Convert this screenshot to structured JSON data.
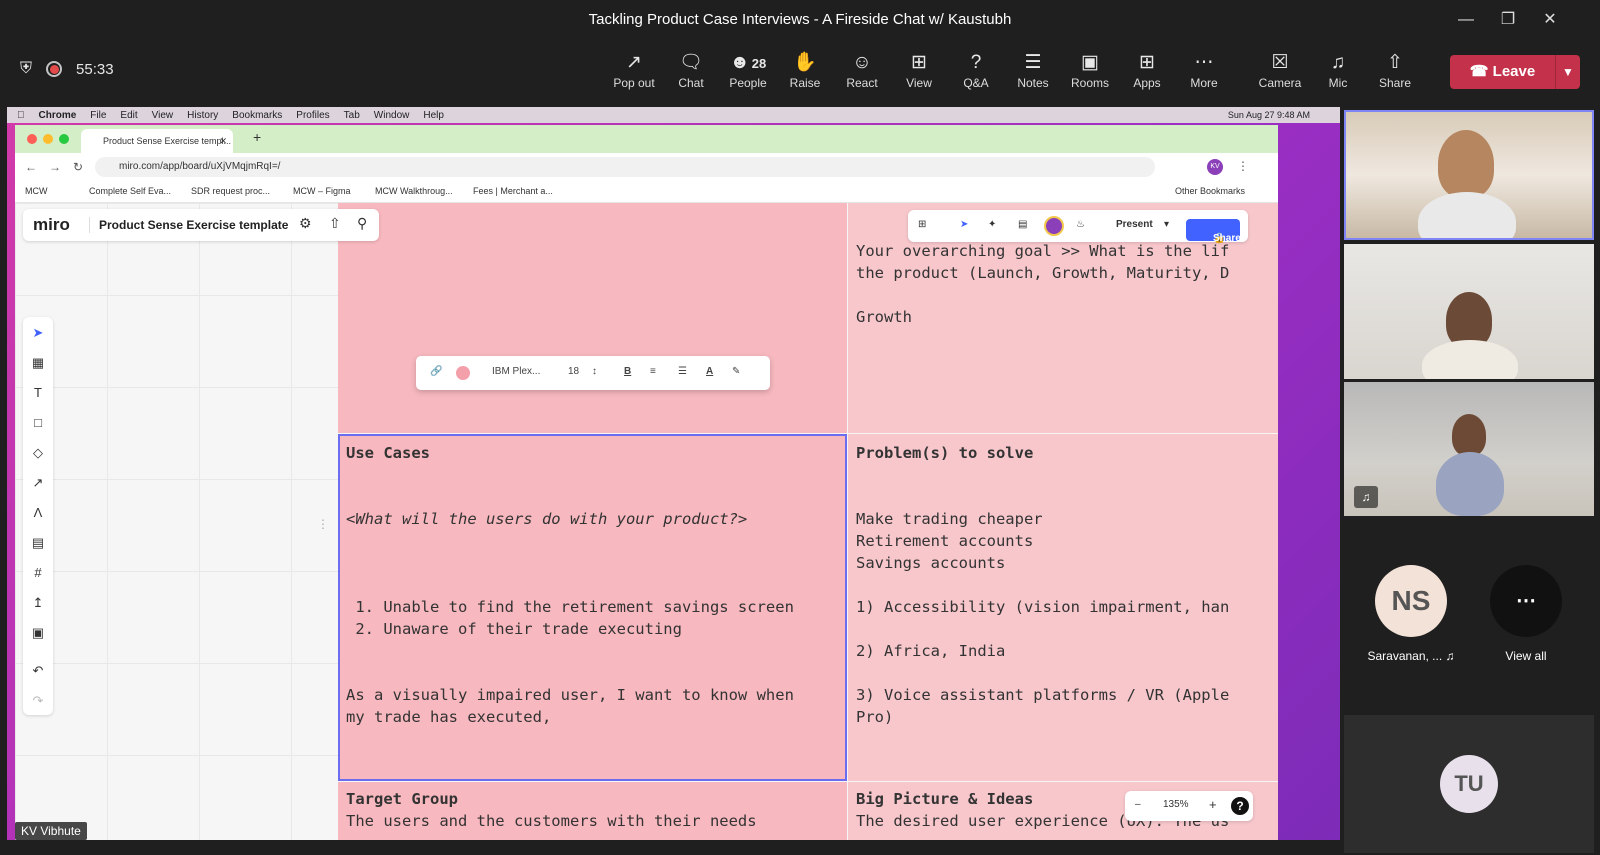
{
  "window": {
    "title": "Tackling Product Case Interviews - A Fireside Chat w/ Kaustubh"
  },
  "meeting": {
    "timer": "55:33",
    "tools": [
      {
        "label": "Pop out",
        "icon": "pop-out-icon"
      },
      {
        "label": "Chat",
        "icon": "chat-icon"
      },
      {
        "label": "People",
        "icon": "people-icon",
        "badge": "28"
      },
      {
        "label": "Raise",
        "icon": "hand-icon"
      },
      {
        "label": "React",
        "icon": "smiley-icon"
      },
      {
        "label": "View",
        "icon": "grid-icon"
      },
      {
        "label": "Q&A",
        "icon": "qa-icon"
      },
      {
        "label": "Notes",
        "icon": "notes-icon"
      },
      {
        "label": "Rooms",
        "icon": "rooms-icon"
      },
      {
        "label": "Apps",
        "icon": "plus-icon"
      },
      {
        "label": "More",
        "icon": "more-icon"
      },
      {
        "label": "Camera",
        "icon": "camera-off-icon"
      },
      {
        "label": "Mic",
        "icon": "mic-off-icon"
      },
      {
        "label": "Share",
        "icon": "share-icon"
      }
    ],
    "leave_label": "Leave",
    "leave_color": "#c4314b",
    "presenter_name": "KV Vibhute"
  },
  "mac": {
    "menu": [
      "Chrome",
      "File",
      "Edit",
      "View",
      "History",
      "Bookmarks",
      "Profiles",
      "Tab",
      "Window",
      "Help"
    ],
    "clock": "Sun Aug 27  9:48 AM"
  },
  "browser": {
    "tab_title": "Product Sense Exercise templ...",
    "url": "miro.com/app/board/uXjVMqjmRqI=/",
    "bookmarks": [
      "MCW",
      "Complete Self Eva...",
      "SDR request proc...",
      "MCW – Figma",
      "MCW Walkthroug...",
      "Fees | Merchant a..."
    ],
    "other_bookmarks": "Other Bookmarks",
    "profile": "KV"
  },
  "miro": {
    "logo": "miro",
    "board_title": "Product Sense Exercise template",
    "font_name": "IBM Plex...",
    "font_size": "18",
    "present_label": "Present",
    "share_label": "Share",
    "zoom": "135%",
    "accent": "#4262ff",
    "cells": {
      "top_right": "Your overarching goal >> What is the lif\nthe product (Launch, Growth, Maturity, D\n\nGrowth",
      "use_cases_title": "Use Cases",
      "use_cases_body": "<What will the users do with your product?>",
      "use_cases_list": " 1. Unable to find the retirement savings screen\n 2. Unaware of their trade executing",
      "use_cases_story": "As a visually impaired user, I want to know when\nmy trade has executed,",
      "problems_title": "Problem(s) to solve",
      "problems_body": "Make trading cheaper\nRetirement accounts\nSavings accounts\n\n1) Accessibility (vision impairment, han\n\n2) Africa, India\n\n3) Voice assistant platforms / VR (Apple\nPro)",
      "target_title": "Target Group",
      "target_body": "The users and the customers with their needs",
      "big_title": "Big Picture & Ideas",
      "big_body": "The desired user experience (UX). The us"
    }
  },
  "participants": {
    "ns_initials": "NS",
    "ns_name": "Saravanan, ...",
    "view_all": "View all",
    "tu_initials": "TU"
  }
}
